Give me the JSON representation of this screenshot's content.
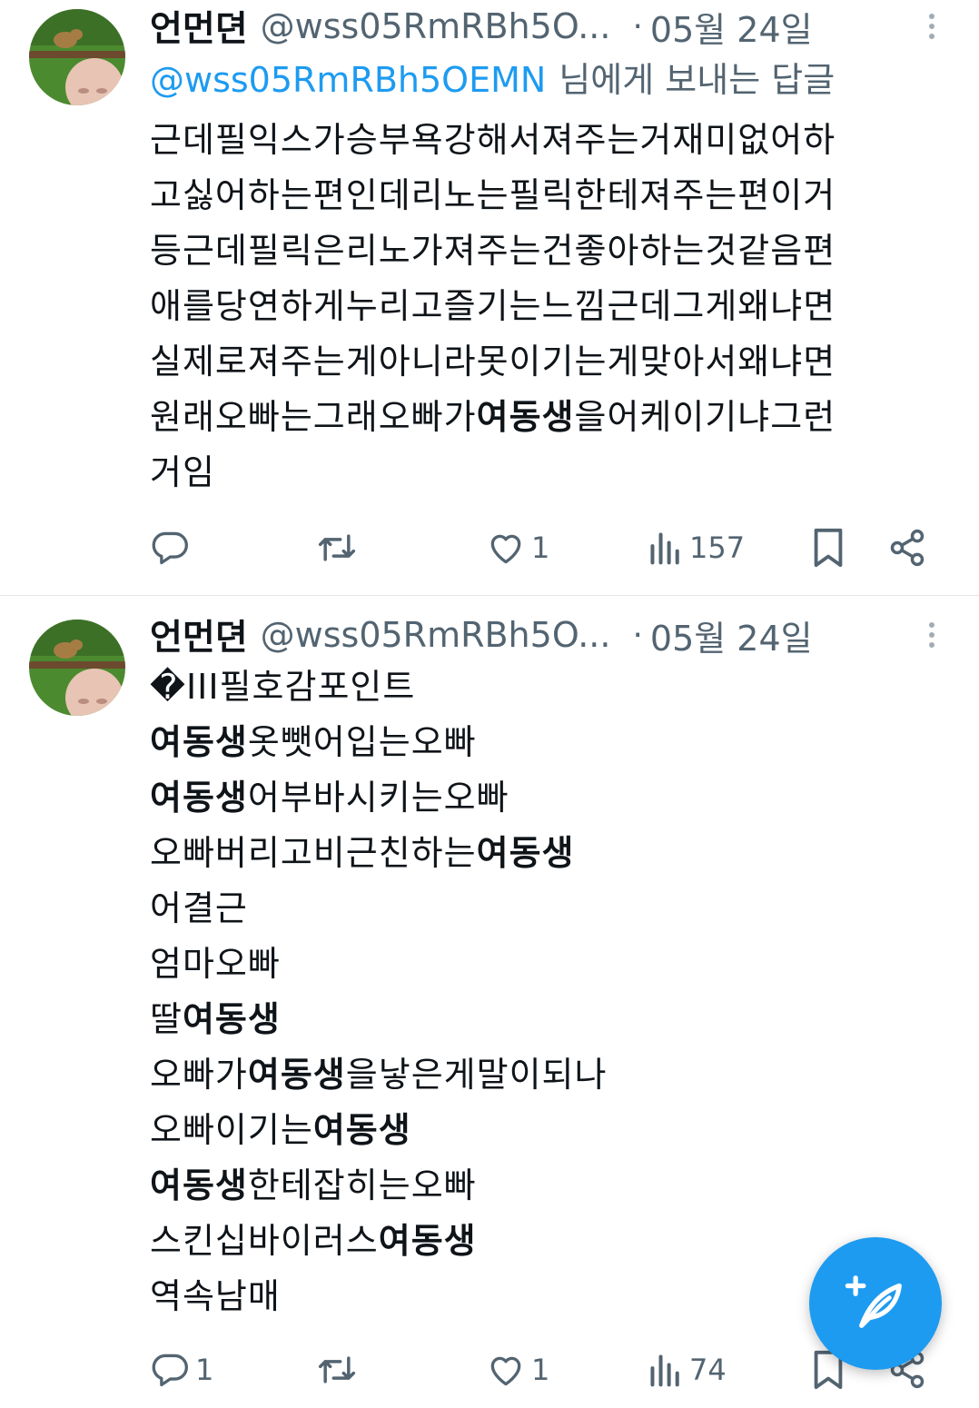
{
  "tweets": [
    {
      "author_name": "언먼뎐",
      "handle": "@wss05RmRBh5O...",
      "date": "05월 24일",
      "reply_to": "@wss05RmRBh5OEMN",
      "reply_suffix": "님에게 보내는 답글",
      "lines": [
        [
          {
            "t": "근데필익스가승부욕강해서져주는거재미없어하",
            "b": false
          }
        ],
        [
          {
            "t": "고싫어하는편인데리노는필릭한테져주는편이거",
            "b": false
          }
        ],
        [
          {
            "t": "등근데필릭은리노가져주는건좋아하는것같음편",
            "b": false
          }
        ],
        [
          {
            "t": "애를당연하게누리고즐기는느낌근데그게왜냐면",
            "b": false
          }
        ],
        [
          {
            "t": "실제로져주는게아니라못이기는게맞아서왜냐면",
            "b": false
          }
        ],
        [
          {
            "t": "원래오빠는그래오빠가",
            "b": false
          },
          {
            "t": "여동생",
            "b": true
          },
          {
            "t": "을어케이기냐그런",
            "b": false
          }
        ],
        [
          {
            "t": "거임",
            "b": false
          }
        ]
      ],
      "actions": {
        "reply_count": "",
        "retweet_count": "",
        "like_count": "1",
        "views_count": "157"
      }
    },
    {
      "author_name": "언먼뎐",
      "handle": "@wss05RmRBh5O...",
      "date": "05월 24일",
      "lines": [
        [
          {
            "t": "�III필호감포인트",
            "b": false
          }
        ],
        [
          {
            "t": "여동생",
            "b": true
          },
          {
            "t": "옷뺏어입는오빠",
            "b": false
          }
        ],
        [
          {
            "t": "여동생",
            "b": true
          },
          {
            "t": "어부바시키는오빠",
            "b": false
          }
        ],
        [
          {
            "t": "오빠버리고비근친하는",
            "b": false
          },
          {
            "t": "여동생",
            "b": true
          }
        ],
        [
          {
            "t": "어결근",
            "b": false
          }
        ],
        [
          {
            "t": "엄마오빠",
            "b": false
          }
        ],
        [
          {
            "t": "딸",
            "b": false
          },
          {
            "t": "여동생",
            "b": true
          }
        ],
        [
          {
            "t": "오빠가",
            "b": false
          },
          {
            "t": "여동생",
            "b": true
          },
          {
            "t": "을낳은게말이되나",
            "b": false
          }
        ],
        [
          {
            "t": "오빠이기는",
            "b": false
          },
          {
            "t": "여동생",
            "b": true
          }
        ],
        [
          {
            "t": "여동생",
            "b": true
          },
          {
            "t": "한테잡히는오빠",
            "b": false
          }
        ],
        [
          {
            "t": "스킨십바이러스",
            "b": false
          },
          {
            "t": "여동생",
            "b": true
          }
        ],
        [
          {
            "t": "역속남매",
            "b": false
          }
        ]
      ],
      "actions": {
        "reply_count": "1",
        "retweet_count": "",
        "like_count": "1",
        "views_count": "74"
      }
    }
  ],
  "icons": {
    "avatar": "avatar-photo",
    "more": "more-vertical-icon",
    "reply": "reply-icon",
    "retweet": "retweet-icon",
    "like": "heart-icon",
    "views": "views-icon",
    "bookmark": "bookmark-icon",
    "share": "share-icon",
    "compose": "compose-feather-icon"
  },
  "colors": {
    "accent": "#1d9bf0",
    "secondary_text": "#536471",
    "primary_text": "#0f1419"
  }
}
